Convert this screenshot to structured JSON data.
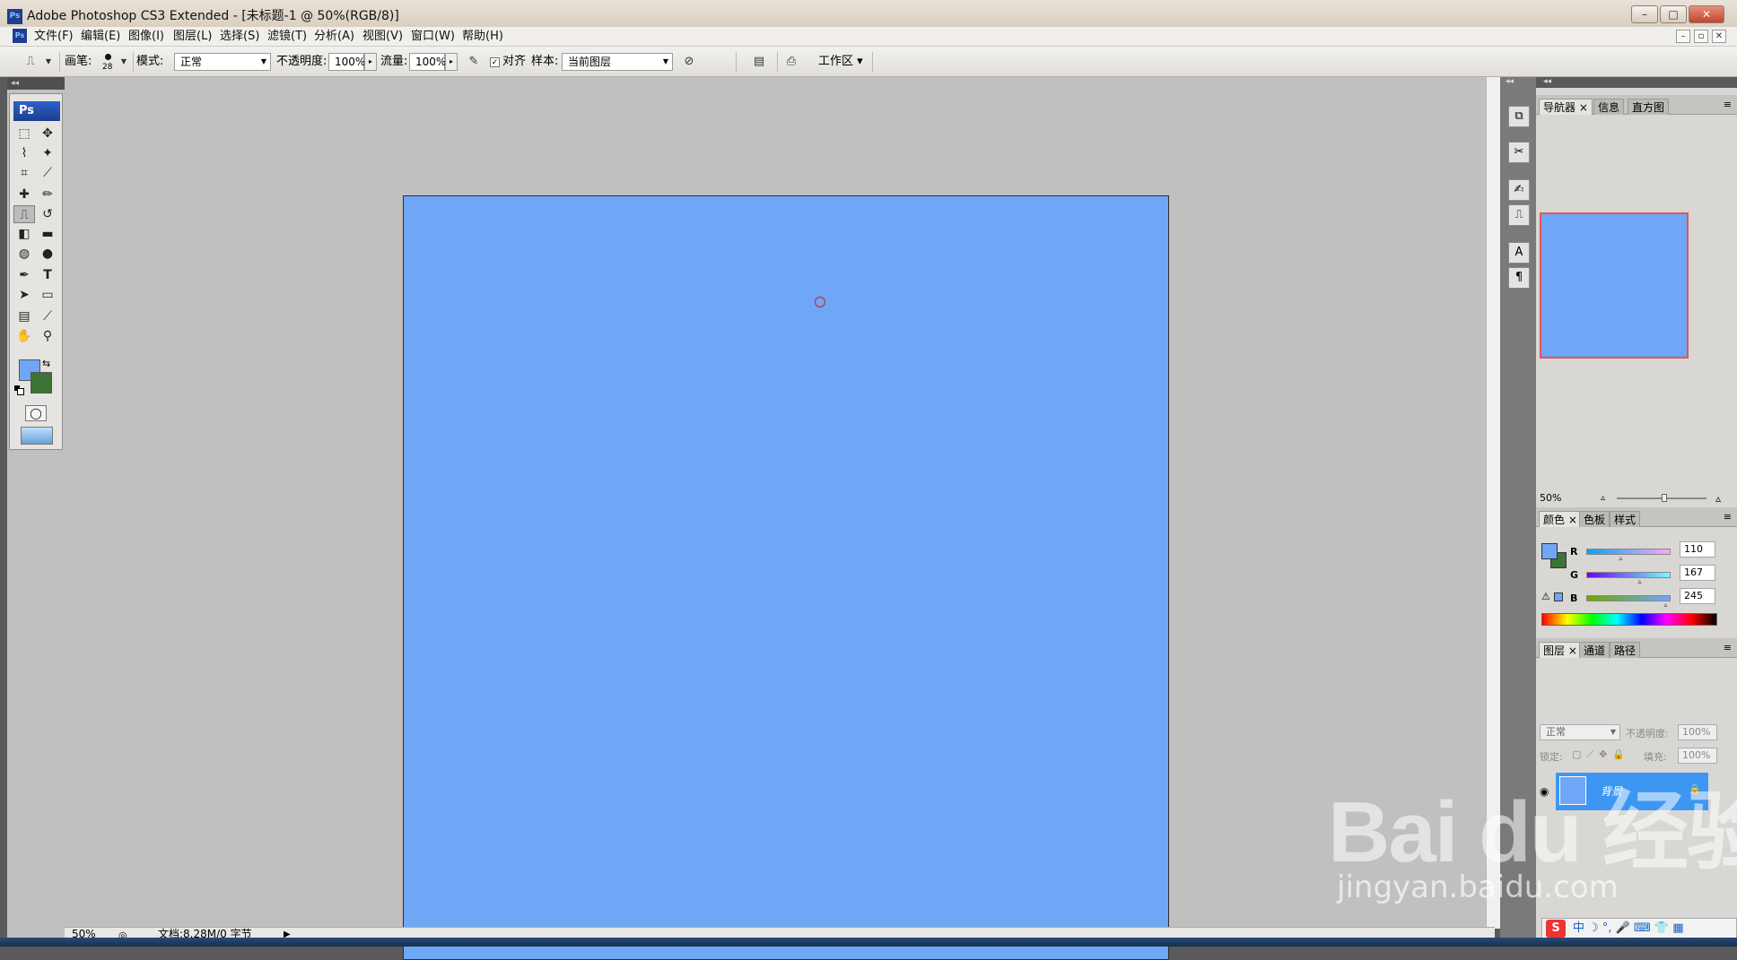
{
  "window": {
    "title": "Adobe Photoshop CS3 Extended - [未标题-1 @ 50%(RGB/8)]",
    "ps_badge": "Ps",
    "controls": {
      "minimize": "–",
      "maximize": "□",
      "close": "✕"
    }
  },
  "menu": {
    "items": [
      "文件(F)",
      "编辑(E)",
      "图像(I)",
      "图层(L)",
      "选择(S)",
      "滤镜(T)",
      "分析(A)",
      "视图(V)",
      "窗口(W)",
      "帮助(H)"
    ],
    "doc_controls": {
      "minimize": "–",
      "restore": "▫",
      "close": "✕"
    }
  },
  "options": {
    "brush_label": "画笔:",
    "brush_size": "28",
    "mode_label": "模式:",
    "mode_value": "正常",
    "opacity_label": "不透明度:",
    "opacity_value": "100%",
    "flow_label": "流量:",
    "flow_value": "100%",
    "aligned_label": "对齐",
    "sample_label": "样本:",
    "sample_value": "当前图层",
    "workspace_label": "工作区 ▾"
  },
  "toolbox": {
    "ps_label": "Ps",
    "strip_label": "◂◂",
    "fg_color": "#6fa6f5",
    "bg_color": "#3b7436"
  },
  "status": {
    "zoom": "50%",
    "doc_info": "文档:8.28M/0 字节"
  },
  "navigator": {
    "tabs": [
      "导航器",
      "信息",
      "直方图"
    ],
    "zoom": "50%"
  },
  "color_panel": {
    "tabs": [
      "颜色",
      "色板",
      "样式"
    ],
    "channels": [
      {
        "name": "R",
        "value": 110
      },
      {
        "name": "G",
        "value": 167
      },
      {
        "name": "B",
        "value": 245
      }
    ]
  },
  "layers_panel": {
    "tabs": [
      "图层",
      "通道",
      "路径"
    ],
    "mode": "正常",
    "opacity_label": "不透明度:",
    "opacity_value": "100%",
    "lock_label": "锁定:",
    "fill_label": "填充:",
    "fill_value": "100%",
    "layer_name": "背景"
  },
  "watermark": {
    "logo": "Bai du 经验",
    "url": "jingyan.baidu.com"
  },
  "ime": {
    "logo": "S",
    "mode": "中 ☽ °, 🎤 ⌨ 👕 ▦"
  },
  "canvas_color": "#6fa6f5"
}
